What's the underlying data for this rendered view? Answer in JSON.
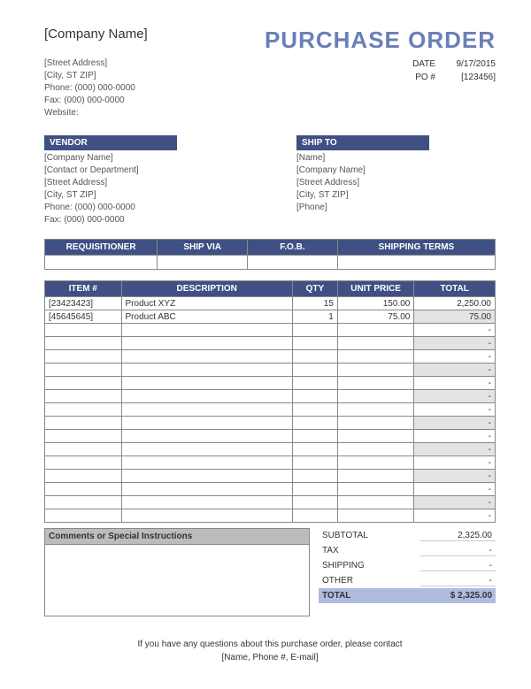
{
  "header": {
    "company_name": "[Company Name]",
    "title": "PURCHASE ORDER",
    "date_label": "DATE",
    "date_value": "9/17/2015",
    "po_label": "PO #",
    "po_value": "[123456]"
  },
  "company": {
    "street": "[Street Address]",
    "city": "[City, ST  ZIP]",
    "phone": "Phone: (000) 000-0000",
    "fax": "Fax: (000) 000-0000",
    "website": "Website:"
  },
  "vendor": {
    "header": "VENDOR",
    "lines": [
      "[Company Name]",
      "[Contact or Department]",
      "[Street Address]",
      "[City, ST  ZIP]",
      "Phone: (000) 000-0000",
      "Fax: (000) 000-0000"
    ]
  },
  "shipto": {
    "header": "SHIP TO",
    "lines": [
      "[Name]",
      "[Company Name]",
      "[Street Address]",
      "[City, ST  ZIP]",
      "[Phone]"
    ]
  },
  "req_headers": [
    "REQUISITIONER",
    "SHIP VIA",
    "F.O.B.",
    "SHIPPING TERMS"
  ],
  "item_headers": [
    "ITEM #",
    "DESCRIPTION",
    "QTY",
    "UNIT PRICE",
    "TOTAL"
  ],
  "items": [
    {
      "item": "[23423423]",
      "desc": "Product XYZ",
      "qty": "15",
      "price": "150.00",
      "total": "2,250.00"
    },
    {
      "item": "[45645645]",
      "desc": "Product ABC",
      "qty": "1",
      "price": "75.00",
      "total": "75.00"
    }
  ],
  "empty_rows": 15,
  "dash": "-",
  "comments_header": "Comments or Special Instructions",
  "totals": {
    "subtotal_label": "SUBTOTAL",
    "subtotal": "2,325.00",
    "tax_label": "TAX",
    "tax": "-",
    "shipping_label": "SHIPPING",
    "shipping": "-",
    "other_label": "OTHER",
    "other": "-",
    "total_label": "TOTAL",
    "total": "$      2,325.00"
  },
  "footer": {
    "line1": "If you have any questions about this purchase order, please contact",
    "line2": "[Name, Phone #, E-mail]"
  }
}
